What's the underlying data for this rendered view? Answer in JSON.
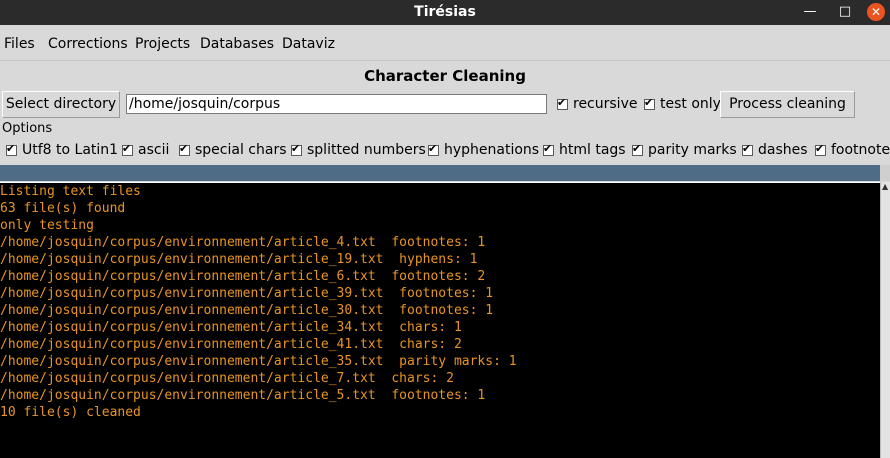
{
  "window": {
    "title": "Tirésias"
  },
  "menu": [
    "Files",
    "Corrections",
    "Projects",
    "Databases",
    "Dataviz"
  ],
  "page": {
    "title": "Character Cleaning"
  },
  "toolbar": {
    "select_directory_label": "Select directory",
    "directory_value": "/home/josquin/corpus",
    "recursive_label": "recursive",
    "recursive_checked": true,
    "test_only_label": "test only",
    "test_only_checked": true,
    "process_label": "Process cleaning"
  },
  "options": {
    "label": "Options",
    "items": [
      {
        "label": "Utf8 to Latin1",
        "checked": true
      },
      {
        "label": "ascii",
        "checked": true
      },
      {
        "label": "special chars",
        "checked": true
      },
      {
        "label": "splitted numbers",
        "checked": true
      },
      {
        "label": "hyphenations",
        "checked": true
      },
      {
        "label": "html tags",
        "checked": true
      },
      {
        "label": "parity marks",
        "checked": true
      },
      {
        "label": "dashes",
        "checked": true
      },
      {
        "label": "footnotes",
        "checked": true
      }
    ]
  },
  "console": {
    "lines": [
      "Listing text files",
      "63 file(s) found",
      "only testing",
      "/home/josquin/corpus/environnement/article_4.txt  footnotes: 1",
      "/home/josquin/corpus/environnement/article_19.txt  hyphens: 1",
      "/home/josquin/corpus/environnement/article_6.txt  footnotes: 2",
      "/home/josquin/corpus/environnement/article_39.txt  footnotes: 1",
      "/home/josquin/corpus/environnement/article_30.txt  footnotes: 1",
      "/home/josquin/corpus/environnement/article_34.txt  chars: 1",
      "/home/josquin/corpus/environnement/article_41.txt  chars: 2",
      "/home/josquin/corpus/environnement/article_35.txt  parity marks: 1",
      "/home/josquin/corpus/environnement/article_7.txt  chars: 2",
      "/home/josquin/corpus/environnement/article_5.txt  footnotes: 1",
      "10 file(s) cleaned"
    ]
  },
  "colors": {
    "console_text": "#e89423",
    "console_bg": "#000000",
    "band": "#4f6c87",
    "close_button": "#e95420"
  },
  "icons": {
    "minimize": "minimize-icon",
    "maximize": "maximize-icon",
    "close": "close-icon"
  }
}
